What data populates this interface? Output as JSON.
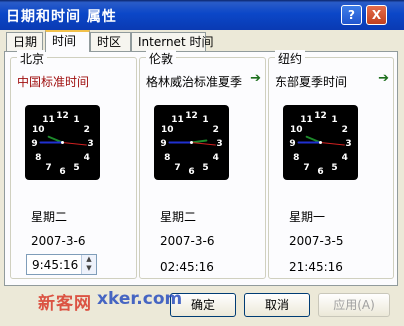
{
  "window": {
    "title": "日期和时间 属性"
  },
  "titlebar": {
    "help_label": "?",
    "close_label": "X"
  },
  "tabs": [
    {
      "label": "日期"
    },
    {
      "label": "时间"
    },
    {
      "label": "时区"
    },
    {
      "label": "Internet 时间"
    }
  ],
  "clocks": [
    {
      "city": "北京",
      "zone": "中国标准时间",
      "day": "星期二",
      "date": "2007-3-6",
      "time": "9:45:16",
      "has_arrow": false
    },
    {
      "city": "伦敦",
      "zone": "格林威治标准夏季",
      "day": "星期二",
      "date": "2007-3-6",
      "time": "02:45:16",
      "has_arrow": true
    },
    {
      "city": "纽约",
      "zone": "东部夏季时间",
      "day": "星期一",
      "date": "2007-3-5",
      "time": "21:45:16",
      "has_arrow": true
    }
  ],
  "clock_numerals": [
    "12",
    "1",
    "2",
    "3",
    "4",
    "5",
    "6",
    "7",
    "8",
    "9",
    "10",
    "11"
  ],
  "buttons": {
    "ok": "确定",
    "cancel": "取消",
    "apply": "应用(A)"
  },
  "watermark": {
    "site": "新客网",
    "brand": "xker.com"
  },
  "colors": {
    "local_zone": "#a01010",
    "arrow": "#1b6e1b",
    "titlebar": "#0b47c8"
  }
}
